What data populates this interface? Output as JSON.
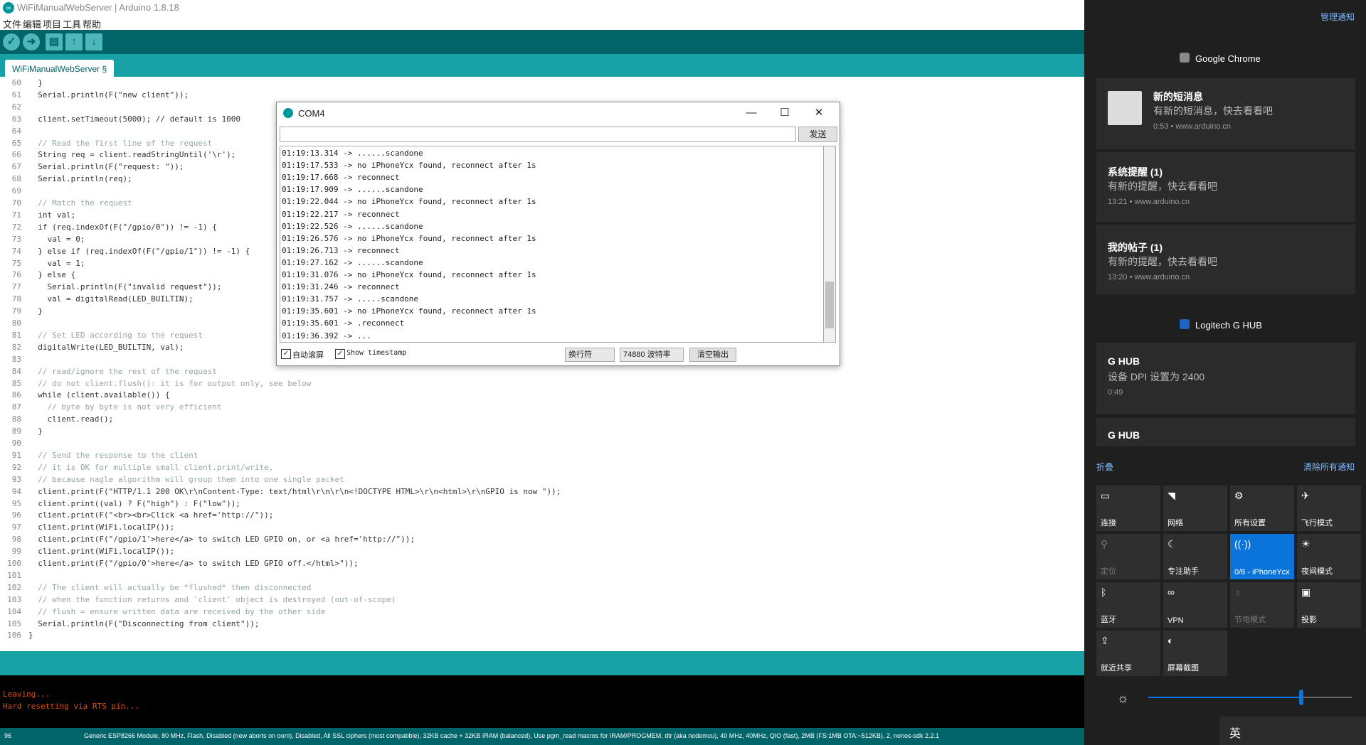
{
  "ide": {
    "title": "WiFiManualWebServer | Arduino 1.8.18",
    "menu": [
      "文件",
      "编辑",
      "项目",
      "工具",
      "帮助"
    ],
    "tab": "WiFiManualWebServer §",
    "line_numbers": [
      "60",
      "61",
      "62",
      "63",
      "64",
      "65",
      "66",
      "67",
      "68",
      "69",
      "70",
      "71",
      "72",
      "73",
      "74",
      "75",
      "76",
      "77",
      "78",
      "79",
      "80",
      "81",
      "82",
      "83",
      "84",
      "85",
      "86",
      "87",
      "88",
      "89",
      "90",
      "91",
      "92",
      "93",
      "94",
      "95",
      "96",
      "97",
      "98",
      "99",
      "100",
      "101",
      "102",
      "103",
      "104",
      "105",
      "106"
    ],
    "code": [
      "  }",
      "  Serial.println(F(\"new client\"));",
      "",
      "  client.setTimeout(5000); // default is 1000",
      "",
      "  // Read the first line of the request",
      "  String req = client.readStringUntil('\\r');",
      "  Serial.println(F(\"request: \"));",
      "  Serial.println(req);",
      "",
      "  // Match the request",
      "  int val;",
      "  if (req.indexOf(F(\"/gpio/0\")) != -1) {",
      "    val = 0;",
      "  } else if (req.indexOf(F(\"/gpio/1\")) != -1) {",
      "    val = 1;",
      "  } else {",
      "    Serial.println(F(\"invalid request\"));",
      "    val = digitalRead(LED_BUILTIN);",
      "  }",
      "",
      "  // Set LED according to the request",
      "  digitalWrite(LED_BUILTIN, val);",
      "",
      "  // read/ignore the rest of the request",
      "  // do not client.flush(): it is for output only, see below",
      "  while (client.available()) {",
      "    // byte by byte is not very efficient",
      "    client.read();",
      "  }",
      "",
      "  // Send the response to the client",
      "  // it is OK for multiple small client.print/write,",
      "  // because nagle algorithm will group them into one single packet",
      "  client.print(F(\"HTTP/1.1 200 OK\\r\\nContent-Type: text/html\\r\\n\\r\\n<!DOCTYPE HTML>\\r\\n<html>\\r\\nGPIO is now \"));",
      "  client.print((val) ? F(\"high\") : F(\"low\"));",
      "  client.print(F(\"<br><br>Click <a href='http://\"));",
      "  client.print(WiFi.localIP());",
      "  client.print(F(\"/gpio/1'>here</a> to switch LED GPIO on, or <a href='http://\"));",
      "  client.print(WiFi.localIP());",
      "  client.print(F(\"/gpio/0'>here</a> to switch LED GPIO off.</html>\"));",
      "",
      "  // The client will actually be *flushed* then disconnected",
      "  // when the function returns and 'client' object is destroyed (out-of-scope)",
      "  // flush = ensure written data are received by the other side",
      "  Serial.println(F(\"Disconnecting from client\"));",
      "}"
    ],
    "console": [
      "Leaving...",
      "Hard resetting via RTS pin..."
    ],
    "status_line": "96",
    "status_board": "Generic ESP8266 Module, 80 MHz, Flash, Disabled (new aborts on oom), Disabled, All SSL ciphers (most compatible), 32KB cache + 32KB IRAM (balanced), Use pgm_read macros for IRAM/PROGMEM, dtr (aka nodemcu), 40 MHz, 40MHz, QIO (fast), 2MB (FS:1MB OTA:~512KB), 2, nonos-sdk 2.2.1"
  },
  "serial": {
    "title": "COM4",
    "send_label": "发送",
    "lines": [
      "01:19:13.314 -> ......scandone",
      "01:19:17.533 -> no iPhoneYcx found, reconnect after 1s",
      "01:19:17.668 -> reconnect",
      "01:19:17.909 -> ......scandone",
      "01:19:22.044 -> no iPhoneYcx found, reconnect after 1s",
      "01:19:22.217 -> reconnect",
      "01:19:22.526 -> ......scandone",
      "01:19:26.576 -> no iPhoneYcx found, reconnect after 1s",
      "01:19:26.713 -> reconnect",
      "01:19:27.162 -> ......scandone",
      "01:19:31.076 -> no iPhoneYcx found, reconnect after 1s",
      "01:19:31.246 -> reconnect",
      "01:19:31.757 -> .....scandone",
      "01:19:35.601 -> no iPhoneYcx found, reconnect after 1s",
      "01:19:35.601 -> .reconnect",
      "01:19:36.392 -> ..."
    ],
    "autoscroll_label": "自动滚屏",
    "timestamp_label": "Show timestamp",
    "line_ending": "换行符",
    "baud": "74880 波特率",
    "clear_label": "清空输出"
  },
  "action_center": {
    "manage_label": "管理通知",
    "chrome_app": "Google Chrome",
    "notifications": [
      {
        "title": "新的短消息",
        "body": "有新的短消息，快去看看吧",
        "meta": "0:53 • www.arduino.cn"
      },
      {
        "title": "系统提醒 (1)",
        "body": "有新的提醒，快去看看吧",
        "meta": "13:21 • www.arduino.cn"
      },
      {
        "title": "我的帖子 (1)",
        "body": "有新的提醒，快去看看吧",
        "meta": "13:20 • www.arduino.cn"
      }
    ],
    "ghub_app": "Logitech G HUB",
    "ghub_notifications": [
      {
        "title": "G HUB",
        "body": "设备 DPI 设置为 2400",
        "meta": "0:49"
      },
      {
        "title": "G HUB"
      }
    ],
    "collapse_label": "折叠",
    "clear_all_label": "清除所有通知",
    "quick_actions": [
      {
        "label": "连接",
        "icon": "connect-icon"
      },
      {
        "label": "网络",
        "icon": "network-icon"
      },
      {
        "label": "所有设置",
        "icon": "gear-icon"
      },
      {
        "label": "飞行模式",
        "icon": "airplane-icon"
      },
      {
        "label": "定位",
        "icon": "location-icon"
      },
      {
        "label": "专注助手",
        "icon": "moon-icon"
      },
      {
        "label": "0/8 - iPhoneYcx",
        "icon": "hotspot-icon"
      },
      {
        "label": "夜间模式",
        "icon": "sun-icon"
      },
      {
        "label": "蓝牙",
        "icon": "bluetooth-icon"
      },
      {
        "label": "VPN",
        "icon": "vpn-icon"
      },
      {
        "label": "节电模式",
        "icon": "battery-icon"
      },
      {
        "label": "投影",
        "icon": "project-icon"
      },
      {
        "label": "就近共享",
        "icon": "share-icon"
      },
      {
        "label": "屏幕截图",
        "icon": "screenshot-icon"
      }
    ],
    "brightness_level": 0.75,
    "ime": "英"
  }
}
